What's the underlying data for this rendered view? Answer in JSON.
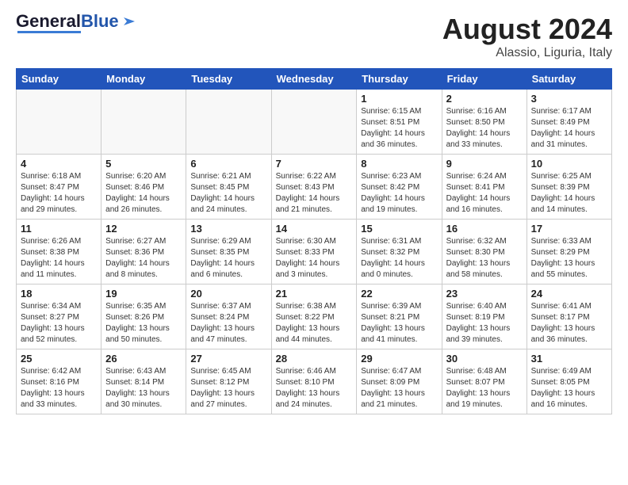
{
  "header": {
    "logo_general": "General",
    "logo_blue": "Blue",
    "main_title": "August 2024",
    "subtitle": "Alassio, Liguria, Italy"
  },
  "days_of_week": [
    "Sunday",
    "Monday",
    "Tuesday",
    "Wednesday",
    "Thursday",
    "Friday",
    "Saturday"
  ],
  "weeks": [
    [
      {
        "day": "",
        "info": ""
      },
      {
        "day": "",
        "info": ""
      },
      {
        "day": "",
        "info": ""
      },
      {
        "day": "",
        "info": ""
      },
      {
        "day": "1",
        "info": "Sunrise: 6:15 AM\nSunset: 8:51 PM\nDaylight: 14 hours\nand 36 minutes."
      },
      {
        "day": "2",
        "info": "Sunrise: 6:16 AM\nSunset: 8:50 PM\nDaylight: 14 hours\nand 33 minutes."
      },
      {
        "day": "3",
        "info": "Sunrise: 6:17 AM\nSunset: 8:49 PM\nDaylight: 14 hours\nand 31 minutes."
      }
    ],
    [
      {
        "day": "4",
        "info": "Sunrise: 6:18 AM\nSunset: 8:47 PM\nDaylight: 14 hours\nand 29 minutes."
      },
      {
        "day": "5",
        "info": "Sunrise: 6:20 AM\nSunset: 8:46 PM\nDaylight: 14 hours\nand 26 minutes."
      },
      {
        "day": "6",
        "info": "Sunrise: 6:21 AM\nSunset: 8:45 PM\nDaylight: 14 hours\nand 24 minutes."
      },
      {
        "day": "7",
        "info": "Sunrise: 6:22 AM\nSunset: 8:43 PM\nDaylight: 14 hours\nand 21 minutes."
      },
      {
        "day": "8",
        "info": "Sunrise: 6:23 AM\nSunset: 8:42 PM\nDaylight: 14 hours\nand 19 minutes."
      },
      {
        "day": "9",
        "info": "Sunrise: 6:24 AM\nSunset: 8:41 PM\nDaylight: 14 hours\nand 16 minutes."
      },
      {
        "day": "10",
        "info": "Sunrise: 6:25 AM\nSunset: 8:39 PM\nDaylight: 14 hours\nand 14 minutes."
      }
    ],
    [
      {
        "day": "11",
        "info": "Sunrise: 6:26 AM\nSunset: 8:38 PM\nDaylight: 14 hours\nand 11 minutes."
      },
      {
        "day": "12",
        "info": "Sunrise: 6:27 AM\nSunset: 8:36 PM\nDaylight: 14 hours\nand 8 minutes."
      },
      {
        "day": "13",
        "info": "Sunrise: 6:29 AM\nSunset: 8:35 PM\nDaylight: 14 hours\nand 6 minutes."
      },
      {
        "day": "14",
        "info": "Sunrise: 6:30 AM\nSunset: 8:33 PM\nDaylight: 14 hours\nand 3 minutes."
      },
      {
        "day": "15",
        "info": "Sunrise: 6:31 AM\nSunset: 8:32 PM\nDaylight: 14 hours\nand 0 minutes."
      },
      {
        "day": "16",
        "info": "Sunrise: 6:32 AM\nSunset: 8:30 PM\nDaylight: 13 hours\nand 58 minutes."
      },
      {
        "day": "17",
        "info": "Sunrise: 6:33 AM\nSunset: 8:29 PM\nDaylight: 13 hours\nand 55 minutes."
      }
    ],
    [
      {
        "day": "18",
        "info": "Sunrise: 6:34 AM\nSunset: 8:27 PM\nDaylight: 13 hours\nand 52 minutes."
      },
      {
        "day": "19",
        "info": "Sunrise: 6:35 AM\nSunset: 8:26 PM\nDaylight: 13 hours\nand 50 minutes."
      },
      {
        "day": "20",
        "info": "Sunrise: 6:37 AM\nSunset: 8:24 PM\nDaylight: 13 hours\nand 47 minutes."
      },
      {
        "day": "21",
        "info": "Sunrise: 6:38 AM\nSunset: 8:22 PM\nDaylight: 13 hours\nand 44 minutes."
      },
      {
        "day": "22",
        "info": "Sunrise: 6:39 AM\nSunset: 8:21 PM\nDaylight: 13 hours\nand 41 minutes."
      },
      {
        "day": "23",
        "info": "Sunrise: 6:40 AM\nSunset: 8:19 PM\nDaylight: 13 hours\nand 39 minutes."
      },
      {
        "day": "24",
        "info": "Sunrise: 6:41 AM\nSunset: 8:17 PM\nDaylight: 13 hours\nand 36 minutes."
      }
    ],
    [
      {
        "day": "25",
        "info": "Sunrise: 6:42 AM\nSunset: 8:16 PM\nDaylight: 13 hours\nand 33 minutes."
      },
      {
        "day": "26",
        "info": "Sunrise: 6:43 AM\nSunset: 8:14 PM\nDaylight: 13 hours\nand 30 minutes."
      },
      {
        "day": "27",
        "info": "Sunrise: 6:45 AM\nSunset: 8:12 PM\nDaylight: 13 hours\nand 27 minutes."
      },
      {
        "day": "28",
        "info": "Sunrise: 6:46 AM\nSunset: 8:10 PM\nDaylight: 13 hours\nand 24 minutes."
      },
      {
        "day": "29",
        "info": "Sunrise: 6:47 AM\nSunset: 8:09 PM\nDaylight: 13 hours\nand 21 minutes."
      },
      {
        "day": "30",
        "info": "Sunrise: 6:48 AM\nSunset: 8:07 PM\nDaylight: 13 hours\nand 19 minutes."
      },
      {
        "day": "31",
        "info": "Sunrise: 6:49 AM\nSunset: 8:05 PM\nDaylight: 13 hours\nand 16 minutes."
      }
    ]
  ]
}
